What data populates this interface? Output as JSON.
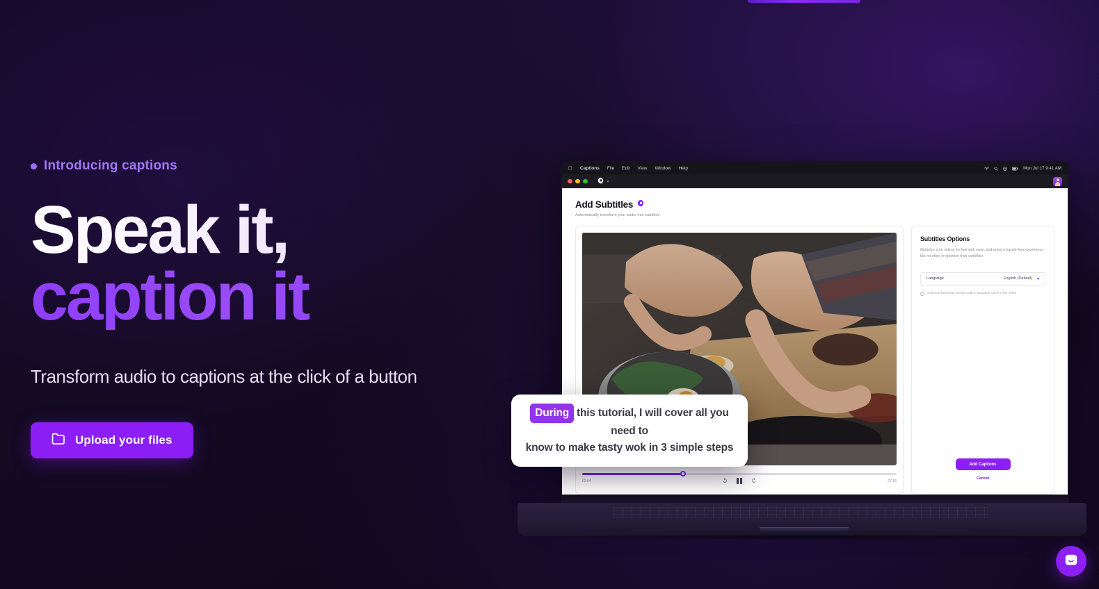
{
  "hero": {
    "eyebrow": "Introducing captions",
    "headline_line1": "Speak it,",
    "headline_line2": "caption it",
    "subhead": "Transform audio to captions at the click of a button",
    "upload_button": "Upload your files",
    "upload_icon": "folder-icon",
    "accent_purple": "#8b1ff5",
    "eyebrow_purple": "#a078f4"
  },
  "macos": {
    "apple_logo": "apple-logo-icon",
    "menus": [
      "Captions",
      "File",
      "Edit",
      "View",
      "Window",
      "Help"
    ],
    "tray_icons": [
      "wifi-icon",
      "search-icon",
      "control-center-icon",
      "battery-icon"
    ],
    "clock": "Mon Jul 17   9:41 AM"
  },
  "window": {
    "traffic_lights": [
      "close",
      "minimize",
      "zoom"
    ],
    "app_logo": "captions-logo-icon",
    "chevron": "chevron-down-icon",
    "avatar": "user-avatar"
  },
  "app": {
    "title": "Add Subtitles",
    "title_logo": "captions-logo-icon",
    "subtitle": "Automatically transform your audio into subtitles.",
    "player": {
      "current_time": "02:54",
      "total_time": "07:15",
      "progress_percent": 32,
      "rewind_icon": "rewind-10-icon",
      "pause_icon": "pause-icon",
      "forward_icon": "forward-10-icon"
    },
    "options": {
      "heading": "Subtitles Options",
      "description": "Optimize your videos for free with ease, and enjoy a hassle-free experience like no other to optimize their workflow.",
      "language_label": "Language",
      "language_value": "English (Default)",
      "language_chevron": "chevron-down-icon",
      "hint_icon": "info-icon",
      "hint": "Selected language should match language used in the video",
      "primary_button": "Add Captions",
      "secondary_button": "Cancel"
    }
  },
  "caption_overlay": {
    "highlight_word": "During",
    "text_line1": "this tutorial, I will cover all you need to",
    "text_line2": "know to make tasty wok in 3 simple steps",
    "highlight_color": "#9333ea"
  },
  "chat": {
    "icon": "intercom-message-icon",
    "color": "#8b1ff5"
  }
}
